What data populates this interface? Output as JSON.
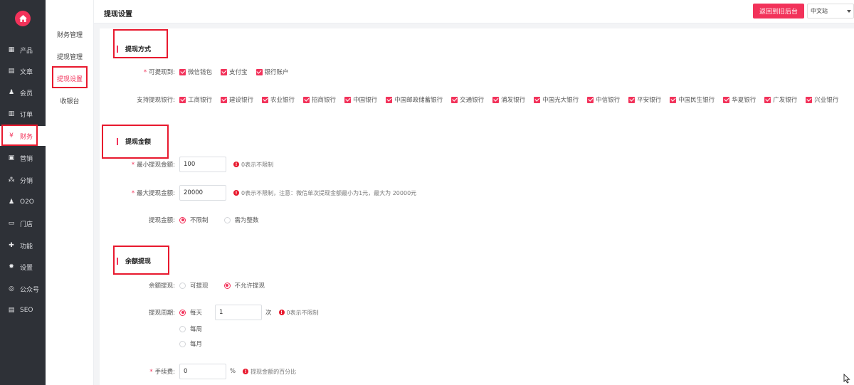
{
  "nav": {
    "items": [
      {
        "label": "产品",
        "icon": "grid-icon",
        "glyph": "▦"
      },
      {
        "label": "文章",
        "icon": "document-icon",
        "glyph": "▤"
      },
      {
        "label": "会员",
        "icon": "user-icon",
        "glyph": "♟"
      },
      {
        "label": "订单",
        "icon": "list-icon",
        "glyph": "▥"
      },
      {
        "label": "财务",
        "icon": "yen-icon",
        "glyph": "¥"
      },
      {
        "label": "营销",
        "icon": "gift-icon",
        "glyph": "▣"
      },
      {
        "label": "分销",
        "icon": "share-icon",
        "glyph": "⁂"
      },
      {
        "label": "O2O",
        "icon": "o2o-user-icon",
        "glyph": "♟"
      },
      {
        "label": "门店",
        "icon": "store-icon",
        "glyph": "▭"
      },
      {
        "label": "功能",
        "icon": "puzzle-icon",
        "glyph": "✚"
      },
      {
        "label": "设置",
        "icon": "gear-icon",
        "glyph": "✹"
      },
      {
        "label": "公众号",
        "icon": "wechat-icon",
        "glyph": "◎"
      },
      {
        "label": "SEO",
        "icon": "seo-doc-icon",
        "glyph": "▤"
      }
    ]
  },
  "submenu": {
    "items": [
      "财务管理",
      "提现管理",
      "提现设置",
      "收银台"
    ]
  },
  "header": {
    "title": "提现设置",
    "back_button": "返回到旧后台",
    "lang_select": "中文站"
  },
  "sections": {
    "method": {
      "title": "提现方式",
      "channels_label": "可提现到:",
      "channels": [
        "微信钱包",
        "支付宝",
        "银行账户"
      ],
      "banks_label": "支持提现银行:",
      "banks": [
        "工商银行",
        "建设银行",
        "农业银行",
        "招商银行",
        "中国银行",
        "中国邮政储蓄银行",
        "交通银行",
        "浦发银行",
        "中国光大银行",
        "中信银行",
        "平安银行",
        "中国民生银行",
        "华夏银行",
        "广发银行",
        "兴业银行"
      ]
    },
    "amount": {
      "title": "提现金额",
      "min_label": "最小提现金额:",
      "min_value": "100",
      "min_hint": "0表示不限制",
      "max_label": "最大提现金额:",
      "max_value": "20000",
      "max_hint": "0表示不限制，注意：微信单次提现金额最小为1元，最大为 20000元",
      "rule_label": "提现金额:",
      "rule_options": [
        "不限制",
        "需为整数"
      ]
    },
    "balance": {
      "title": "余额提现",
      "enable_label": "余额提现:",
      "enable_options": [
        "可提现",
        "不允许提现"
      ],
      "period_label": "提现周期:",
      "period_options": [
        "每天",
        "每周",
        "每月"
      ],
      "period_value": "1",
      "period_unit": "次",
      "period_hint": "0表示不限制",
      "fee_label": "手续费:",
      "fee_value": "0",
      "fee_unit": "%",
      "fee_hint": "提现金额的百分比"
    }
  },
  "colors": {
    "accent": "#f2325a",
    "sidebar": "#2e3137",
    "annotation": "#e8192e"
  }
}
